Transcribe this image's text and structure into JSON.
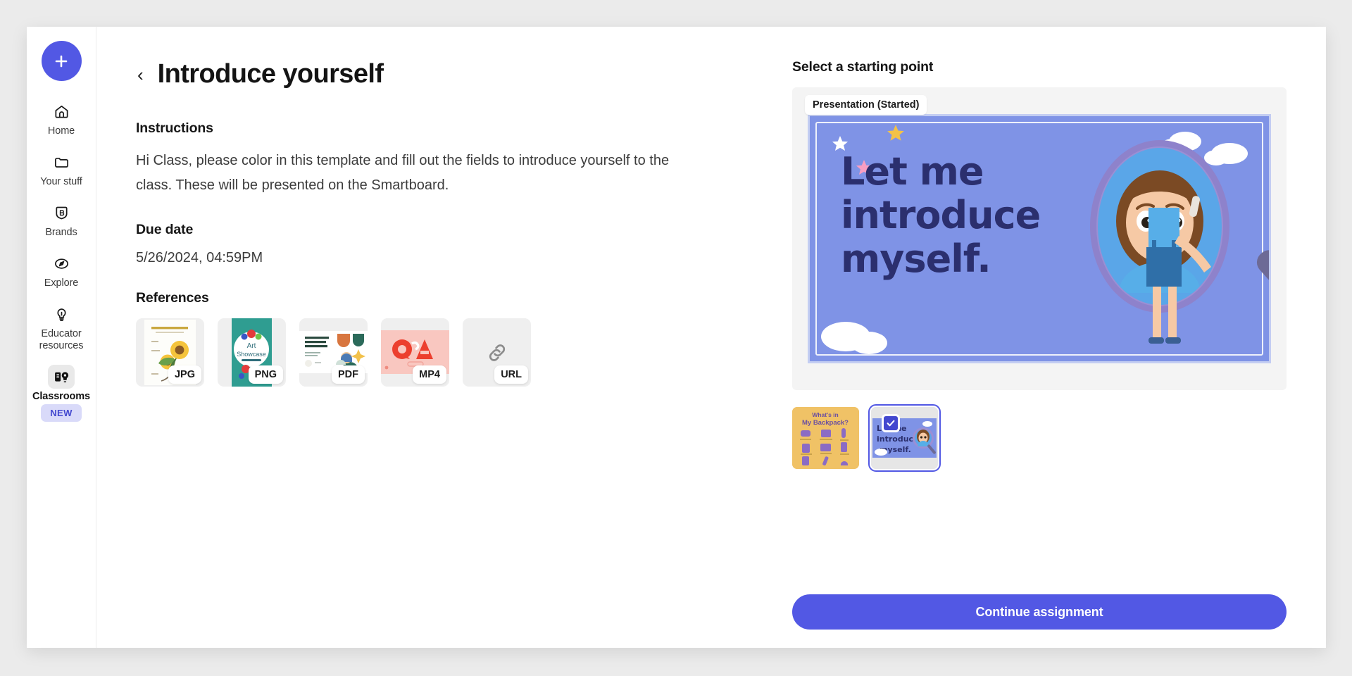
{
  "sidebar": {
    "create_button": {
      "icon": "plus-icon",
      "label": ""
    },
    "items": [
      {
        "icon": "home-icon",
        "label": "Home",
        "active": false
      },
      {
        "icon": "folder-icon",
        "label": "Your stuff",
        "active": false
      },
      {
        "icon": "brand-icon",
        "label": "Brands",
        "active": false
      },
      {
        "icon": "explore-icon",
        "label": "Explore",
        "active": false
      },
      {
        "icon": "bulb-icon",
        "label": "Educator resources",
        "active": false
      },
      {
        "icon": "classroom-icon",
        "label": "Classrooms",
        "active": true
      }
    ],
    "new_badge": "NEW"
  },
  "header": {
    "back_icon": "chevron-left-icon",
    "title": "Introduce yourself"
  },
  "main": {
    "instructions_heading": "Instructions",
    "instructions_text": "Hi Class, please color in this template and fill out the fields to introduce yourself to the class. These will be presented on the Smartboard.",
    "due_date_heading": "Due date",
    "due_date_value": "5/26/2024, 04:59PM",
    "references_heading": "References",
    "references": [
      {
        "type": "JPG",
        "thumb_title": "PARTS OF A PLANT",
        "icon": "sunflower-thumb"
      },
      {
        "type": "PNG",
        "thumb_title": "Art Showcase",
        "icon": "art-showcase-thumb"
      },
      {
        "type": "PDF",
        "thumb_title": "Copywriting Workshop For Beginners",
        "icon": "workshop-thumb"
      },
      {
        "type": "MP4",
        "thumb_title": "Q&A",
        "icon": "qa-video-thumb"
      },
      {
        "type": "URL",
        "thumb_title": "",
        "icon": "link-icon"
      }
    ]
  },
  "starting_point": {
    "heading": "Select a starting point",
    "preview_chip": "Presentation (Started)",
    "slide": {
      "line1": "Let me",
      "line2": "introduce",
      "line3": "myself.",
      "background_color": "#7f93e6",
      "text_color": "#2b2f6e"
    },
    "thumbnails": [
      {
        "name": "backpack-template",
        "line1": "What's in",
        "line2": "My Backpack?",
        "selected": false,
        "background_color": "#f0c266"
      },
      {
        "name": "introduce-myself-template",
        "line1": "Let me",
        "line2": "introduce",
        "line3": "myself.",
        "selected": true,
        "background_color": "#7f93e6"
      }
    ],
    "continue_label": "Continue assignment"
  },
  "colors": {
    "accent": "#5258e4",
    "badge_bg": "#d9daf9",
    "badge_text": "#4348cf",
    "page_bg": "#ebebeb",
    "card_bg": "#ffffff",
    "preview_bg": "#f4f4f4"
  }
}
